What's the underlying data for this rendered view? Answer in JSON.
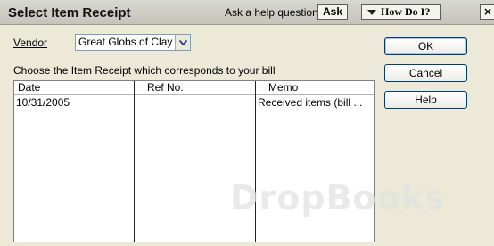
{
  "window": {
    "title": "Select Item Receipt",
    "help_question_label": "Ask a help question",
    "ask_label": "Ask",
    "how_do_i_label": "How Do I?",
    "close_glyph": "×"
  },
  "vendor": {
    "label": "Vendor",
    "value": "Great Globs of Clay"
  },
  "instruction": "Choose the Item Receipt which corresponds to your bill",
  "table": {
    "columns": [
      "Date",
      "Ref No.",
      "Memo"
    ],
    "rows": [
      {
        "date": "10/31/2005",
        "ref_no": "",
        "memo": "Received items (bill ..."
      }
    ]
  },
  "buttons": {
    "ok": "OK",
    "cancel": "Cancel",
    "help": "Help"
  },
  "watermark": "DropBooks",
  "icons": {
    "vendor_dropdown": "chevron-down-icon",
    "how_do_i": "triangle-down-icon",
    "close": "close-icon"
  },
  "colors": {
    "dialog_bg": "#ece9d8",
    "titlebar": "#c4c4bc",
    "button_border": "#003c74"
  }
}
